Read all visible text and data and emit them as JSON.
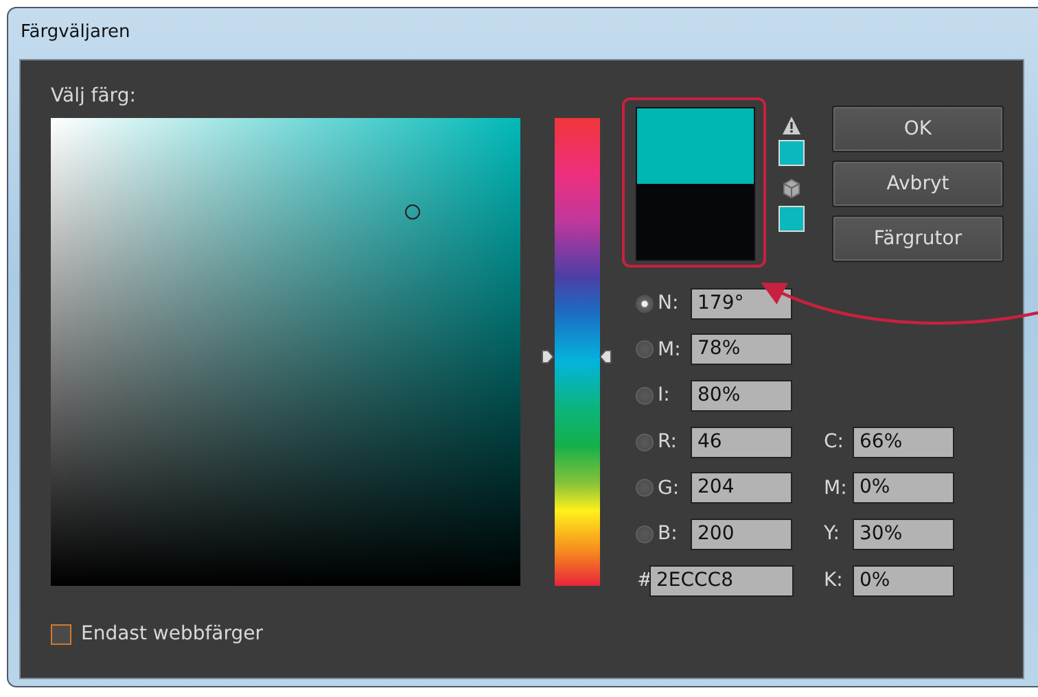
{
  "window": {
    "title": "Färgväljaren"
  },
  "picker": {
    "label": "Välj färg:",
    "hue_slider": {
      "level": 0.49
    }
  },
  "buttons": [
    "OK",
    "Avbryt",
    "Färgrutor"
  ],
  "left_fields": [
    {
      "kind": "radio",
      "label": "N:",
      "value": "179°",
      "selected": true
    },
    {
      "kind": "radio",
      "label": "M:",
      "value": "78%",
      "selected": false
    },
    {
      "kind": "radio",
      "label": "I:",
      "value": "80%",
      "selected": false
    },
    {
      "kind": "radio",
      "label": "R:",
      "value": "46",
      "selected": false
    },
    {
      "kind": "radio",
      "label": "G:",
      "value": "204",
      "selected": false
    },
    {
      "kind": "radio",
      "label": "B:",
      "value": "200",
      "selected": false
    },
    {
      "kind": "plain",
      "label": "#",
      "value": "2ECCC8"
    }
  ],
  "right_fields": [
    {
      "label": "C:",
      "value": "66%"
    },
    {
      "label": "M:",
      "value": "0%"
    },
    {
      "label": "Y:",
      "value": "30%"
    },
    {
      "label": "K:",
      "value": "0%"
    }
  ],
  "web_colors_only": {
    "label": "Endast webbfärger",
    "checked": false
  }
}
